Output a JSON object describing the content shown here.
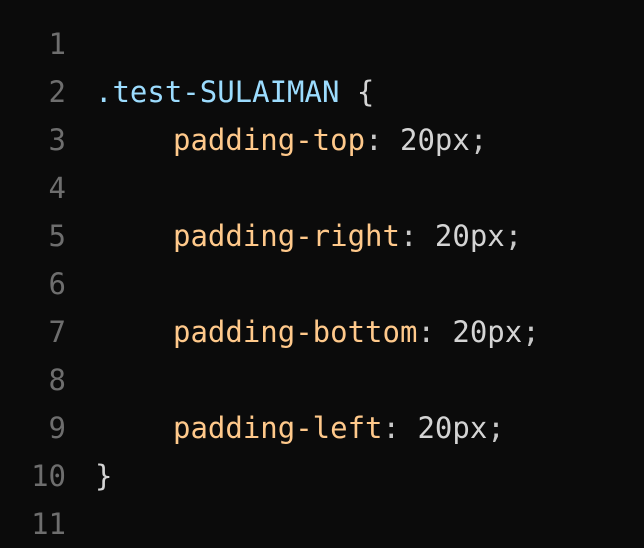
{
  "lines": [
    {
      "num": "1"
    },
    {
      "num": "2",
      "selector": ".test-SULAIMAN",
      "open_brace": "{"
    },
    {
      "num": "3",
      "property": "padding-top",
      "colon": ":",
      "value": "20px",
      "semi": ";"
    },
    {
      "num": "4"
    },
    {
      "num": "5",
      "property": "padding-right",
      "colon": ":",
      "value": "20px",
      "semi": ";"
    },
    {
      "num": "6"
    },
    {
      "num": "7",
      "property": "padding-bottom",
      "colon": ":",
      "value": "20px",
      "semi": ";"
    },
    {
      "num": "8"
    },
    {
      "num": "9",
      "property": "padding-left",
      "colon": ":",
      "value": "20px",
      "semi": ";"
    },
    {
      "num": "10",
      "close_brace": "}"
    },
    {
      "num": "11"
    }
  ],
  "colors": {
    "background": "#0b0b0b",
    "line_number": "#6e6e6e",
    "selector": "#9cdcfe",
    "property": "#ffc98b",
    "value": "#d4d4d4"
  }
}
